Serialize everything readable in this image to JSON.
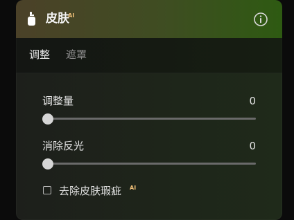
{
  "header": {
    "title": "皮肤",
    "ai_badge": "AI"
  },
  "tabs": [
    {
      "label": "调整",
      "active": true
    },
    {
      "label": "遮罩",
      "active": false
    }
  ],
  "controls": {
    "amount": {
      "label": "调整量",
      "value": "0"
    },
    "remove_glare": {
      "label": "消除反光",
      "value": "0"
    },
    "remove_blemish": {
      "label": "去除皮肤瑕疵",
      "ai_badge": "AI",
      "checked": false
    }
  },
  "icons": {
    "tool": "skin-brush-icon",
    "info": "info-icon"
  },
  "colors": {
    "header_gradient_start": "#4b4128",
    "header_gradient_end": "#2e5a12",
    "ai_badge": "#f0c078"
  }
}
